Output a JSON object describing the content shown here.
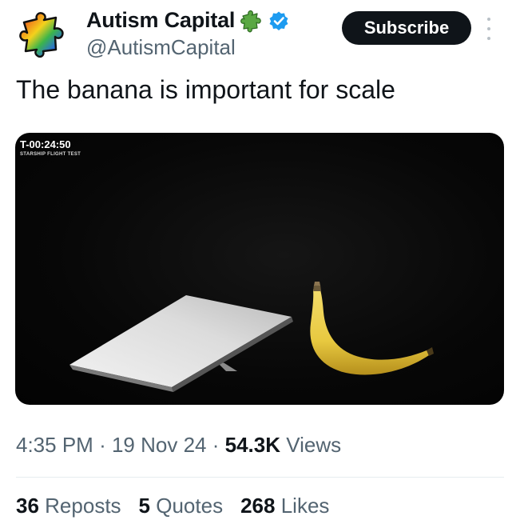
{
  "author": {
    "display_name": "Autism Capital",
    "handle": "@AutismCapital",
    "name_badge_icon": "puzzle-piece-icon",
    "verified_icon": "verified-badge-icon",
    "avatar_icon": "rainbow-puzzle-piece-icon"
  },
  "actions": {
    "subscribe_label": "Subscribe",
    "more_icon": "more-options-icon"
  },
  "tweet": {
    "text": "The banana is important for scale"
  },
  "media": {
    "countdown": "T-00:24:50",
    "countdown_subtitle": "STARSHIP FLIGHT TEST"
  },
  "meta": {
    "time": "4:35 PM",
    "separator": "·",
    "date": "19 Nov 24",
    "views_count": "54.3K",
    "views_label": "Views"
  },
  "stats": {
    "reposts_count": "36",
    "reposts_label": "Reposts",
    "quotes_count": "5",
    "quotes_label": "Quotes",
    "likes_count": "268",
    "likes_label": "Likes"
  },
  "colors": {
    "primary_text": "#0f1419",
    "secondary_text": "#536471",
    "subscribe_bg": "#0f1419",
    "verified_blue": "#1d9bf0",
    "divider": "#e6ecf0"
  }
}
